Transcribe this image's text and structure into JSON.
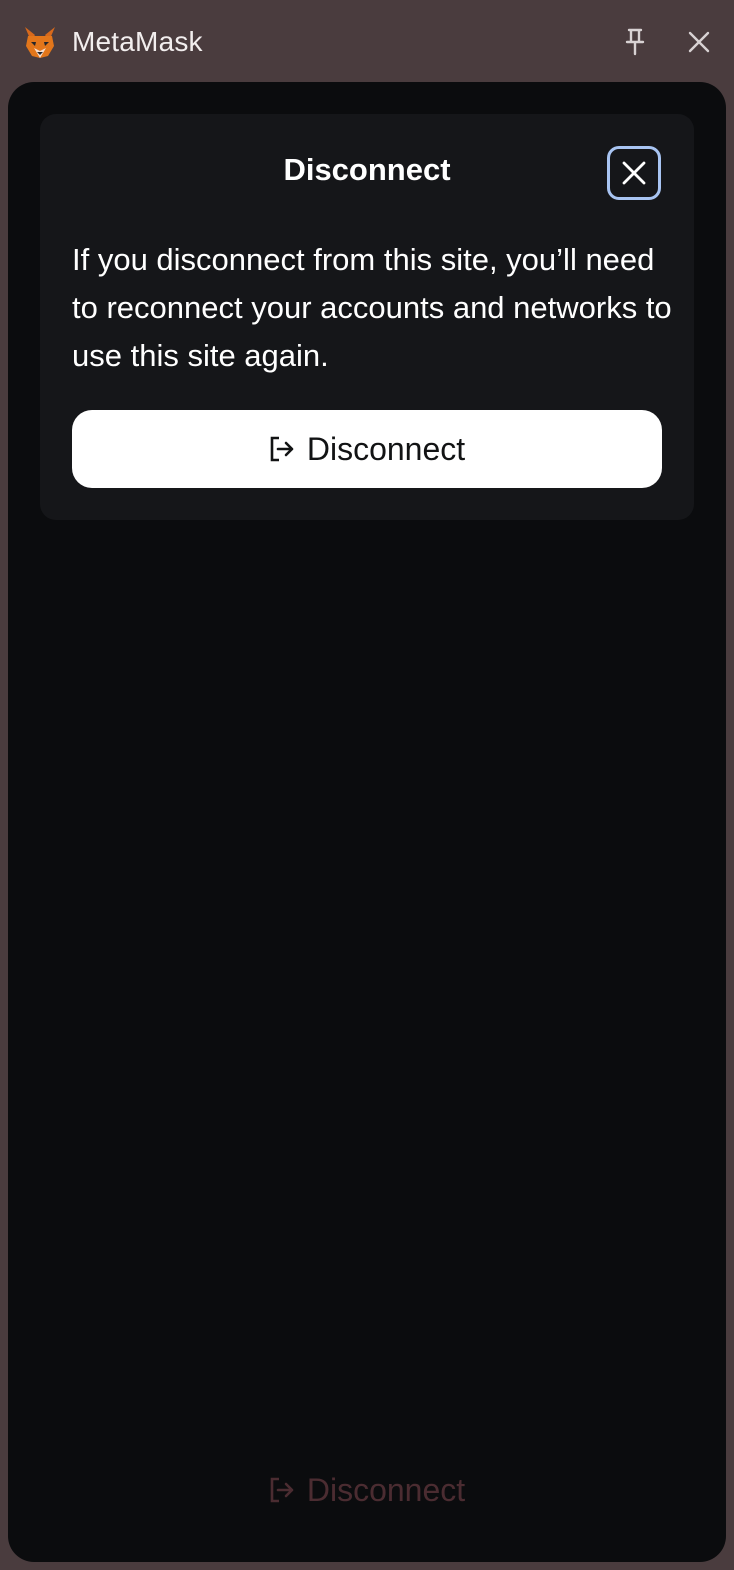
{
  "app": {
    "title": "MetaMask",
    "icons": {
      "logo": "metamask-fox-icon",
      "pin": "pin-icon",
      "close": "close-icon"
    }
  },
  "background": {
    "disconnect_label": "Disconnect",
    "disconnect_icon": "logout-icon",
    "disconnect_color": "#4b2c31"
  },
  "modal": {
    "title": "Disconnect",
    "body": "If you disconnect from this site, you’ll need to reconnect your accounts and networks to use this site again.",
    "close_icon": "close-icon",
    "button": {
      "label": "Disconnect",
      "icon": "logout-icon"
    }
  },
  "colors": {
    "titlebar_bg": "#4a3c3e",
    "window_bg": "#0b0c0e",
    "modal_bg": "#151619",
    "focus_ring": "#a8c4f2",
    "button_bg": "#ffffff"
  }
}
